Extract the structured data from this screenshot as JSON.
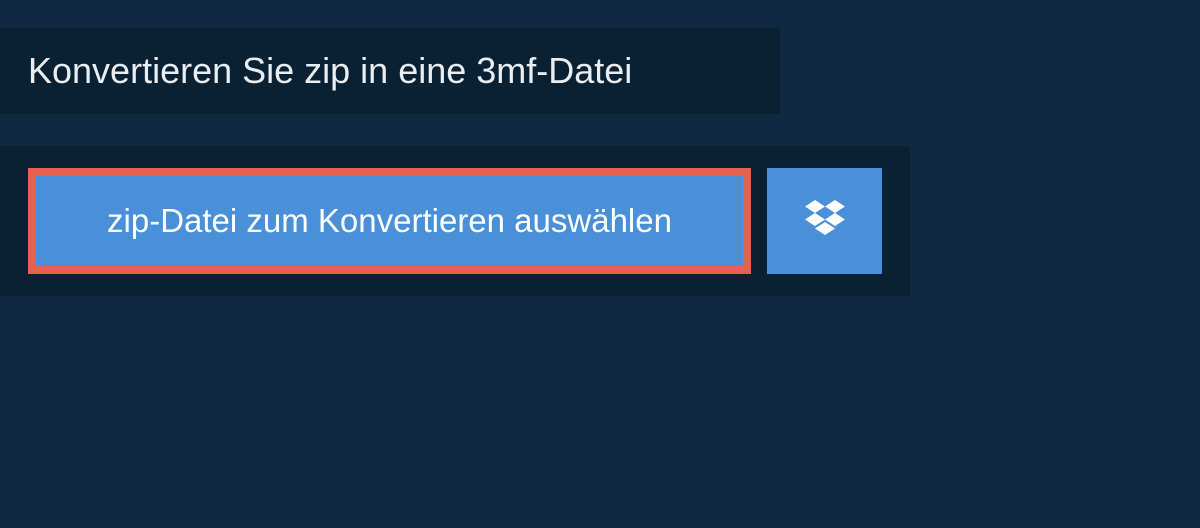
{
  "header": {
    "title": "Konvertieren Sie zip in eine 3mf-Datei"
  },
  "upload": {
    "choose_file_label": "zip-Datei zum Konvertieren auswählen"
  }
}
